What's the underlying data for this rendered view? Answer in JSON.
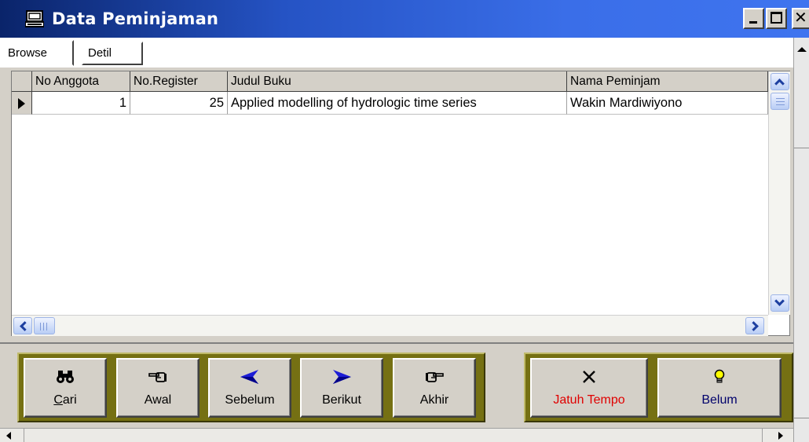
{
  "window": {
    "title": "Data Peminjaman",
    "icon": "computer-icon",
    "controls": [
      "minimize-icon",
      "maximize-icon",
      "close-icon"
    ]
  },
  "tabs": [
    {
      "label": "Browse",
      "active": true
    },
    {
      "label": "Detil",
      "active": false
    }
  ],
  "grid": {
    "columns": [
      "No Anggota",
      "No.Register",
      "Judul Buku",
      "Nama Peminjam"
    ],
    "rows": [
      {
        "no_anggota": "1",
        "no_register": "25",
        "judul_buku": "Applied modelling of hydrologic time series",
        "nama_peminjam": "Wakin Mardiwiyono"
      }
    ]
  },
  "nav_buttons": [
    {
      "label": "Cari",
      "icon": "binoculars-icon"
    },
    {
      "label": "Awal",
      "icon": "hand-left-icon"
    },
    {
      "label": "Sebelum",
      "icon": "arrow-left-icon"
    },
    {
      "label": "Berikut",
      "icon": "arrow-right-icon"
    },
    {
      "label": "Akhir",
      "icon": "hand-right-icon"
    }
  ],
  "filter_buttons": [
    {
      "label": "Jatuh Tempo",
      "icon": "cross-icon",
      "color": "#e00000"
    },
    {
      "label": "Belum",
      "icon": "lightbulb-icon",
      "color": "#00006b"
    }
  ],
  "colors": {
    "title_bar": "#0a246a",
    "button_frame": "#757013",
    "face": "#d4d0c8"
  }
}
